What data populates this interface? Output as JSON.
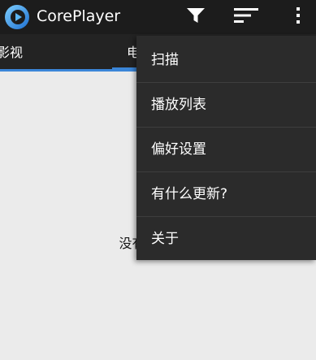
{
  "action_bar": {
    "title": "CorePlayer",
    "logo_icon": "coreplayer-logo-icon",
    "filter_icon": "filter-icon",
    "sort_icon": "sort-icon",
    "overflow_icon": "overflow-menu-icon"
  },
  "tabs": [
    {
      "label": "影视"
    },
    {
      "label": "电"
    }
  ],
  "menu": {
    "items": [
      {
        "label": "扫描"
      },
      {
        "label": "播放列表"
      },
      {
        "label": "偏好设置"
      },
      {
        "label": "有什么更新?"
      },
      {
        "label": "关于"
      }
    ]
  },
  "content": {
    "empty_message": "没有电视节目"
  },
  "colors": {
    "action_bar": "#1c1c1c",
    "tab_strip": "#232323",
    "accent": "#3b86d8",
    "menu_bg": "#2b2b2b",
    "content_bg": "#ebebeb"
  }
}
